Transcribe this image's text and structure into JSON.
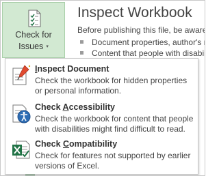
{
  "check_for_issues": {
    "label_line1": "Check for",
    "label_line2": "Issues",
    "caret": "▾"
  },
  "inspect_section": {
    "title": "Inspect Workbook",
    "description": "Before publishing this file, be aware that it contains:",
    "bullets": [
      "Document properties, author's name",
      "Content that people with disabilities"
    ]
  },
  "menu": {
    "items": [
      {
        "title_pre": "",
        "title_key": "I",
        "title_post": "nspect Document",
        "desc_line1": "Check the workbook for hidden properties",
        "desc_line2": "or personal information.",
        "icon": "inspect-document-icon"
      },
      {
        "title_pre": "Check ",
        "title_key": "A",
        "title_post": "ccessibility",
        "desc_line1": "Check the workbook for content that people",
        "desc_line2": "with disabilities might find difficult to read.",
        "icon": "check-accessibility-icon"
      },
      {
        "title_pre": "Check ",
        "title_key": "C",
        "title_post": "ompatibility",
        "desc_line1": "Check for features not supported by earlier",
        "desc_line2": "versions of Excel.",
        "icon": "check-compatibility-icon"
      }
    ]
  },
  "colors": {
    "button_bg": "#d2e9d2",
    "excel_green": "#217346",
    "accent_blue": "#2e6db4"
  }
}
